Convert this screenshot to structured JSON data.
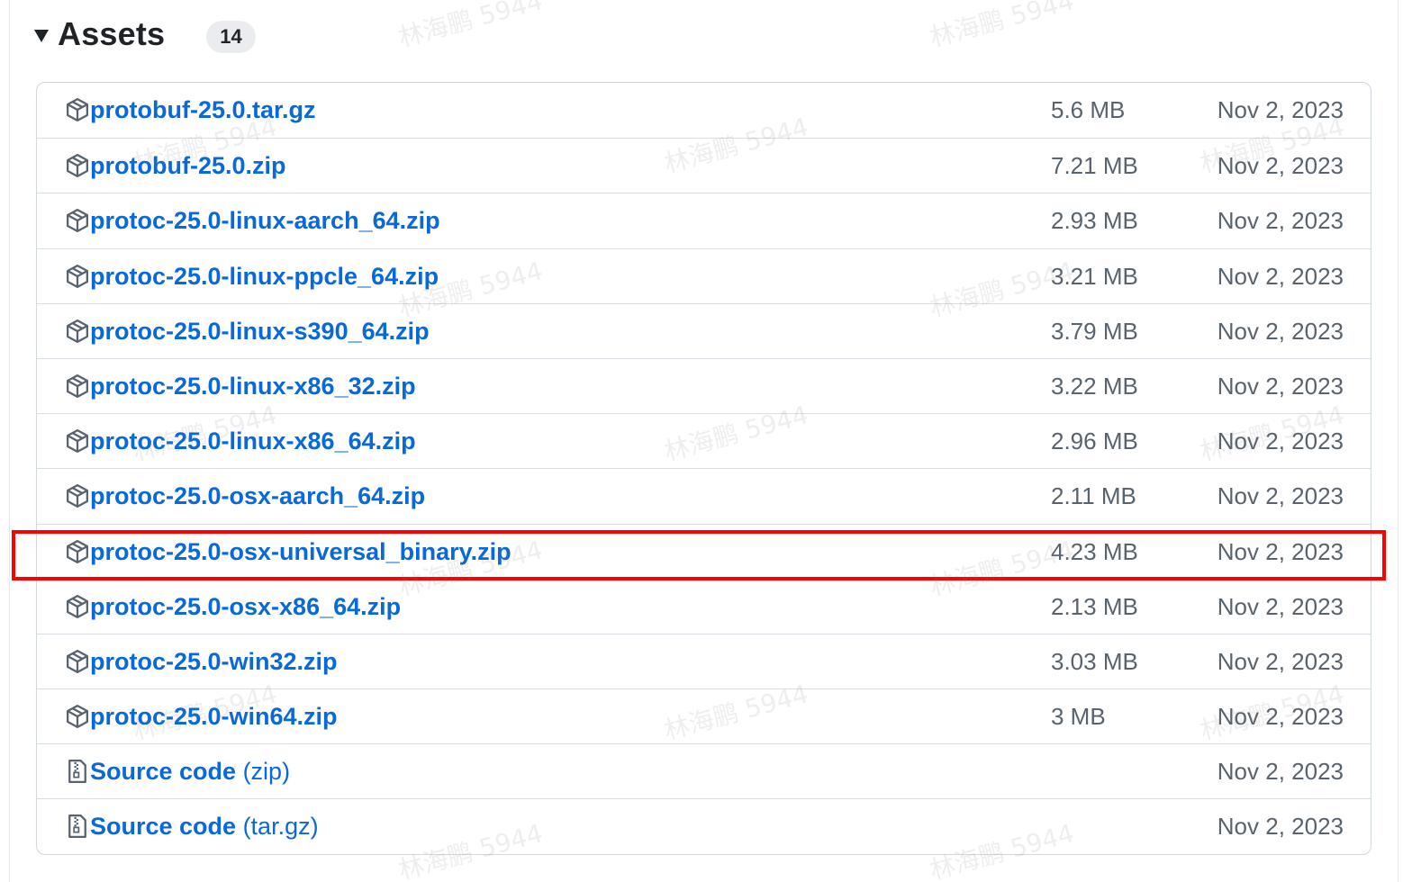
{
  "assets": {
    "title": "Assets",
    "count": "14",
    "items": [
      {
        "name": "protobuf-25.0.tar.gz",
        "suffix": "",
        "size": "5.6 MB",
        "date": "Nov 2, 2023",
        "icon": "package-icon"
      },
      {
        "name": "protobuf-25.0.zip",
        "suffix": "",
        "size": "7.21 MB",
        "date": "Nov 2, 2023",
        "icon": "package-icon"
      },
      {
        "name": "protoc-25.0-linux-aarch_64.zip",
        "suffix": "",
        "size": "2.93 MB",
        "date": "Nov 2, 2023",
        "icon": "package-icon"
      },
      {
        "name": "protoc-25.0-linux-ppcle_64.zip",
        "suffix": "",
        "size": "3.21 MB",
        "date": "Nov 2, 2023",
        "icon": "package-icon"
      },
      {
        "name": "protoc-25.0-linux-s390_64.zip",
        "suffix": "",
        "size": "3.79 MB",
        "date": "Nov 2, 2023",
        "icon": "package-icon"
      },
      {
        "name": "protoc-25.0-linux-x86_32.zip",
        "suffix": "",
        "size": "3.22 MB",
        "date": "Nov 2, 2023",
        "icon": "package-icon"
      },
      {
        "name": "protoc-25.0-linux-x86_64.zip",
        "suffix": "",
        "size": "2.96 MB",
        "date": "Nov 2, 2023",
        "icon": "package-icon"
      },
      {
        "name": "protoc-25.0-osx-aarch_64.zip",
        "suffix": "",
        "size": "2.11 MB",
        "date": "Nov 2, 2023",
        "icon": "package-icon"
      },
      {
        "name": "protoc-25.0-osx-universal_binary.zip",
        "suffix": "",
        "size": "4.23 MB",
        "date": "Nov 2, 2023",
        "icon": "package-icon"
      },
      {
        "name": "protoc-25.0-osx-x86_64.zip",
        "suffix": "",
        "size": "2.13 MB",
        "date": "Nov 2, 2023",
        "icon": "package-icon"
      },
      {
        "name": "protoc-25.0-win32.zip",
        "suffix": "",
        "size": "3.03 MB",
        "date": "Nov 2, 2023",
        "icon": "package-icon"
      },
      {
        "name": "protoc-25.0-win64.zip",
        "suffix": "",
        "size": "3 MB",
        "date": "Nov 2, 2023",
        "icon": "package-icon"
      },
      {
        "name": "Source code",
        "suffix": " (zip)",
        "size": "",
        "date": "Nov 2, 2023",
        "icon": "file-zip-icon"
      },
      {
        "name": "Source code",
        "suffix": " (tar.gz)",
        "size": "",
        "date": "Nov 2, 2023",
        "icon": "file-zip-icon"
      }
    ]
  },
  "watermark": "林海鹏 5944",
  "colors": {
    "link": "#0969da",
    "muted": "#59636e",
    "highlight": "#ff0000",
    "border": "#d0d7de"
  }
}
